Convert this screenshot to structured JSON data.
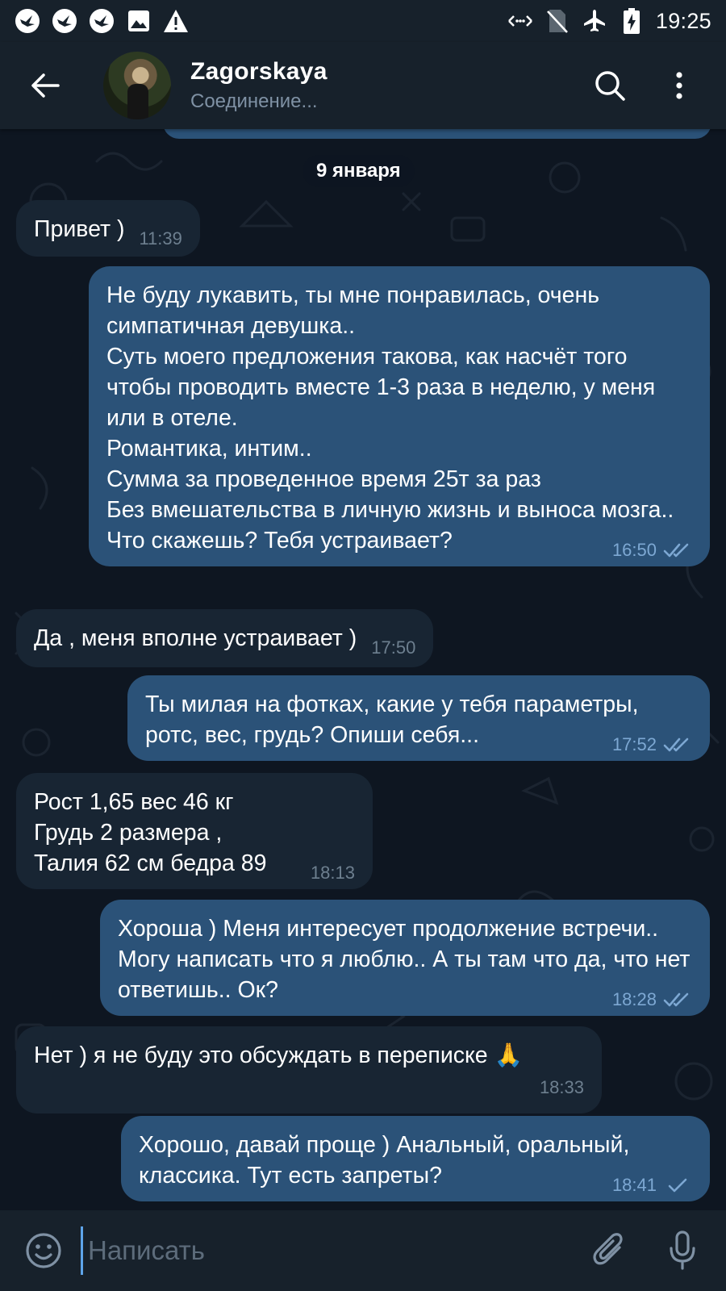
{
  "status_bar": {
    "time": "19:25",
    "left_icons": [
      "app-notification-icon",
      "app-notification-icon",
      "app-notification-icon",
      "image-icon",
      "warning-icon"
    ],
    "right_icons": [
      "data-saver-icon",
      "no-sim-icon",
      "airplane-icon",
      "battery-charging-icon"
    ]
  },
  "header": {
    "name": "Zagorskaya",
    "status": "Соединение..."
  },
  "chat": {
    "date_label": "9 января",
    "messages": [
      {
        "dir": "in",
        "text": "Привет )",
        "time": "11:39"
      },
      {
        "dir": "out",
        "text": "Не буду лукавить, ты мне понравилась, очень симпатичная девушка..\nСуть моего предложения такова, как насчёт того чтобы проводить вместе 1-3 раза в неделю, у меня или в отеле.\nРомантика, интим..\nСумма за проведенное время 25т за раз\nБез вмешательства в личную жизнь и выноса мозга..\nЧто скажешь? Тебя устраивает?",
        "time": "16:50",
        "status": "read"
      },
      {
        "dir": "in",
        "text": "Да , меня вполне устраивает )",
        "time": "17:50"
      },
      {
        "dir": "out",
        "text": "Ты милая на фотках, какие у тебя параметры, ротс, вес, грудь? Опиши себя...",
        "time": "17:52",
        "status": "read"
      },
      {
        "dir": "in",
        "text": "Рост 1,65 вес 46 кг\nГрудь 2 размера ,\nТалия 62 см бедра 89",
        "time": "18:13"
      },
      {
        "dir": "out",
        "text": "Хороша ) Меня интересует продолжение встречи.. Могу написать что я люблю.. А ты там что да, что нет ответишь.. Ок?",
        "time": "18:28",
        "status": "read"
      },
      {
        "dir": "in",
        "text": "Нет ) я не буду это обсуждать в переписке 🙏",
        "time": "18:33"
      },
      {
        "dir": "out",
        "text": "Хорошо, давай проще ) Анальный, оральный, классика. Тут есть запреты?",
        "time": "18:41",
        "status": "sent"
      }
    ]
  },
  "composer": {
    "placeholder": "Написать"
  },
  "colors": {
    "background": "#0e1621",
    "bar": "#17212b",
    "incoming_bubble": "#182533",
    "outgoing_bubble": "#2b5278",
    "accent": "#5ea5ea"
  }
}
